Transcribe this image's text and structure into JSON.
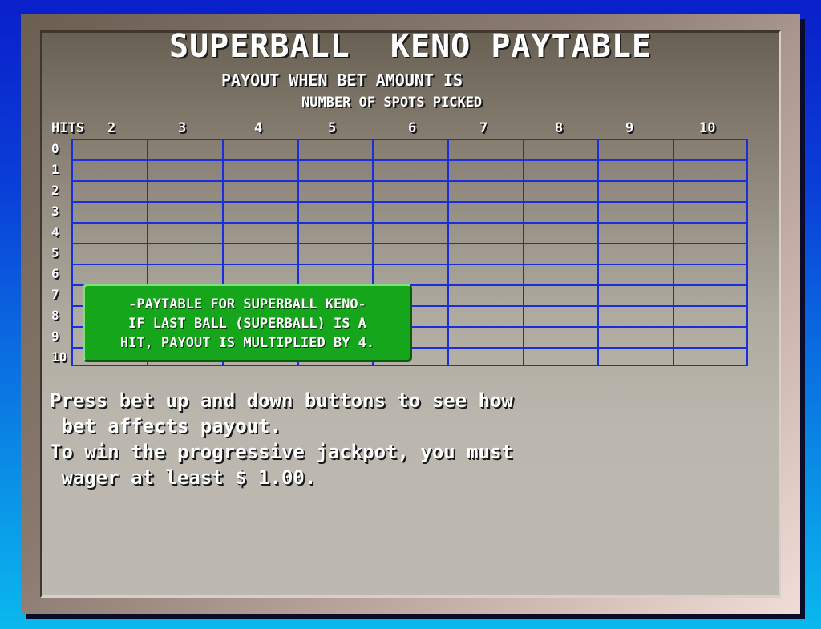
{
  "title": "SUPERBALL  KENO PAYTABLE",
  "subtitle_line1": "PAYOUT WHEN BET AMOUNT IS",
  "subtitle_line2": "NUMBER OF SPOTS PICKED",
  "hits_label": "HITS",
  "spot_columns": [
    "2",
    "3",
    "4",
    "5",
    "6",
    "7",
    "8",
    "9",
    "10"
  ],
  "hit_rows": [
    "0",
    "1",
    "2",
    "3",
    "4",
    "5",
    "6",
    "7",
    "8",
    "9",
    "10"
  ],
  "popup": {
    "line1": "-PAYTABLE FOR SUPERBALL KENO-",
    "line2": "IF LAST BALL (SUPERBALL) IS A",
    "line3": "HIT, PAYOUT IS MULTIPLIED BY 4."
  },
  "info": {
    "line1": "Press bet up and down buttons to see how",
    "line2": " bet affects payout.",
    "line3": "To win the progressive jackpot, you must",
    "line4": " wager at least $ 1.00."
  },
  "colors": {
    "grid": "#1a2ee0",
    "popup": "#16a61c",
    "text": "#ffffff"
  }
}
